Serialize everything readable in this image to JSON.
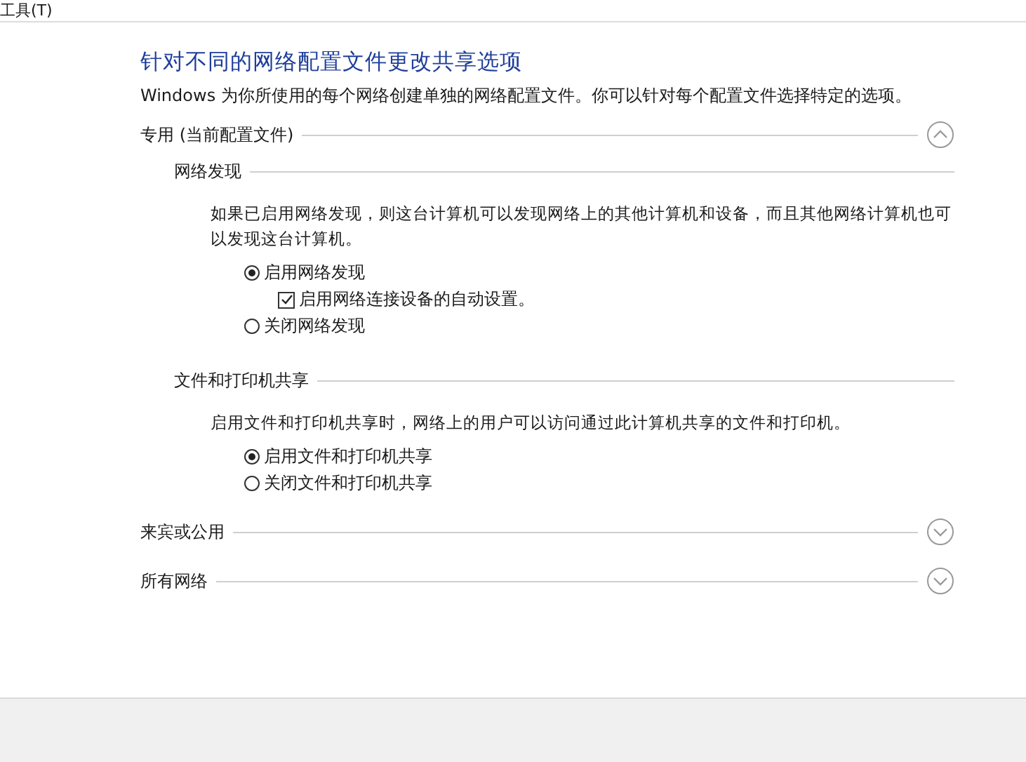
{
  "menu": [
    {
      "label": "工具(T)"
    }
  ],
  "title": "针对不同的网络配置文件更改共享选项",
  "description": "Windows 为你所使用的每个网络创建单独的网络配置文件。你可以针对每个配置文件选择特定的选项。",
  "profiles": [
    {
      "name": "专用 (当前配置文件)",
      "expanded": true,
      "groups": [
        {
          "title": "网络发现",
          "description": "如果已启用网络发现，则这台计算机可以发现网络上的其他计算机和设备，而且其他网络计算机也可以发现这台计算机。",
          "options": [
            {
              "kind": "radio",
              "label": "启用网络发现",
              "selected": true,
              "children": [
                {
                  "kind": "checkbox",
                  "label": "启用网络连接设备的自动设置。",
                  "checked": true
                }
              ]
            },
            {
              "kind": "radio",
              "label": "关闭网络发现",
              "selected": false
            }
          ]
        },
        {
          "title": "文件和打印机共享",
          "description": "启用文件和打印机共享时，网络上的用户可以访问通过此计算机共享的文件和打印机。",
          "options": [
            {
              "kind": "radio",
              "label": "启用文件和打印机共享",
              "selected": true
            },
            {
              "kind": "radio",
              "label": "关闭文件和打印机共享",
              "selected": false
            }
          ]
        }
      ]
    },
    {
      "name": "来宾或公用",
      "expanded": false
    },
    {
      "name": "所有网络",
      "expanded": false
    }
  ]
}
